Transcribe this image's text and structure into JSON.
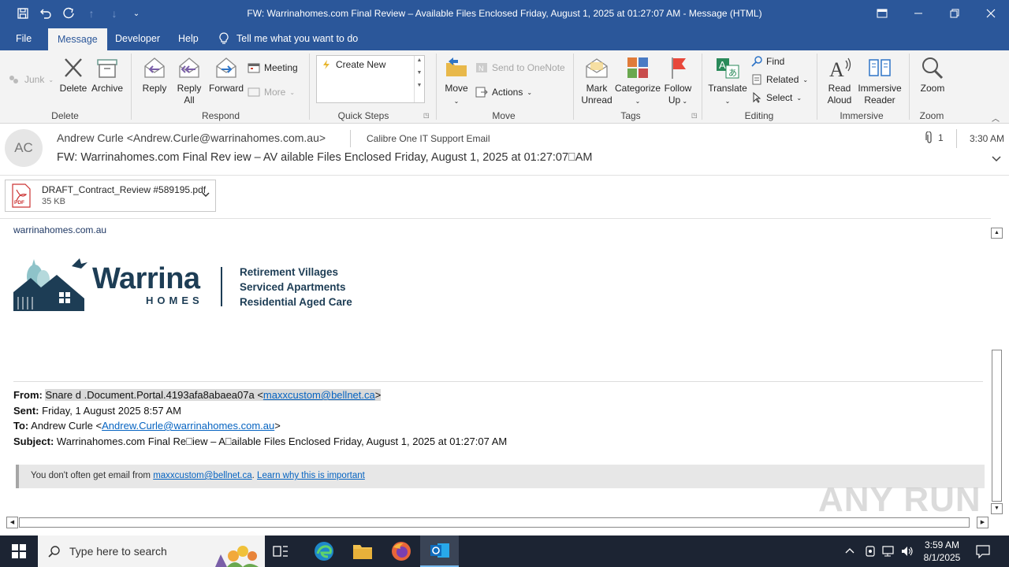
{
  "window": {
    "title": "FW: Warrinahomes.com Final Review – Available Files Enclosed Friday, August 1, 2025 at 01:27:07 AM  -  Message (HTML)"
  },
  "menu": {
    "file": "File",
    "message": "Message",
    "developer": "Developer",
    "help": "Help",
    "tell_me": "Tell me what you want to do"
  },
  "ribbon": {
    "junk": "Junk",
    "delete": "Delete",
    "archive": "Archive",
    "reply": "Reply",
    "reply_all_1": "Reply",
    "reply_all_2": "All",
    "forward": "Forward",
    "meeting": "Meeting",
    "more": "More",
    "create_new": "Create New",
    "move": "Move",
    "send_onenote": "Send to OneNote",
    "actions": "Actions",
    "mark_unread_1": "Mark",
    "mark_unread_2": "Unread",
    "categorize": "Categorize",
    "follow_up_1": "Follow",
    "follow_up_2": "Up",
    "translate": "Translate",
    "find": "Find",
    "related": "Related",
    "select": "Select",
    "read_aloud_1": "Read",
    "read_aloud_2": "Aloud",
    "immersive_1": "Immersive",
    "immersive_2": "Reader",
    "zoom": "Zoom",
    "groups": {
      "delete": "Delete",
      "respond": "Respond",
      "quick_steps": "Quick Steps",
      "move": "Move",
      "tags": "Tags",
      "editing": "Editing",
      "immersive": "Immersive",
      "zoom": "Zoom"
    }
  },
  "message": {
    "avatar_initials": "AC",
    "sender": "Andrew Curle <Andrew.Curle@warrinahomes.com.au>",
    "to": "Calibre One IT Support Email",
    "subject": "FW: Warrinahomes.com Final Rev iew – AV ailable Files Enclosed Friday, August 1, 2025 at 01:27:07⎕AM",
    "attach_count": "1",
    "time": "3:30 AM"
  },
  "attachment": {
    "name": "DRAFT_Contract_Review #589195.pdf",
    "size": "35 KB",
    "badge": "PDF"
  },
  "body": {
    "domain": "warrinahomes.com.au",
    "logo_name": "Warrina",
    "logo_sub": "HOMES",
    "services": [
      "Retirement Villages",
      "Serviced Apartments",
      "Residential Aged Care"
    ],
    "from_label": "From:",
    "from_name": "Snare d .Document.Portal.4193afa8abaea07a <",
    "from_email": "maxxcustom@bellnet.ca",
    "from_end": ">",
    "sent_label": "Sent:",
    "sent_value": "Friday, 1 August 2025 8:57 AM",
    "to_label": "To:",
    "to_name": "Andrew Curle <",
    "to_email": "Andrew.Curle@warrinahomes.com.au",
    "to_end": ">",
    "subject_label": "Subject:",
    "subject_value": "Warrinahomes.com Final Re⎕iew – A⎕ailable Files Enclosed Friday, August 1, 2025 at 01:27:07 AM",
    "warning_text": "You don't often get email from ",
    "warning_email": "maxxcustom@bellnet.ca",
    "warning_dot": ". ",
    "warning_link": "Learn why this is important"
  },
  "taskbar": {
    "search_placeholder": "Type here to search",
    "time": "3:59 AM",
    "date": "8/1/2025"
  },
  "watermark": "ANY RUN"
}
